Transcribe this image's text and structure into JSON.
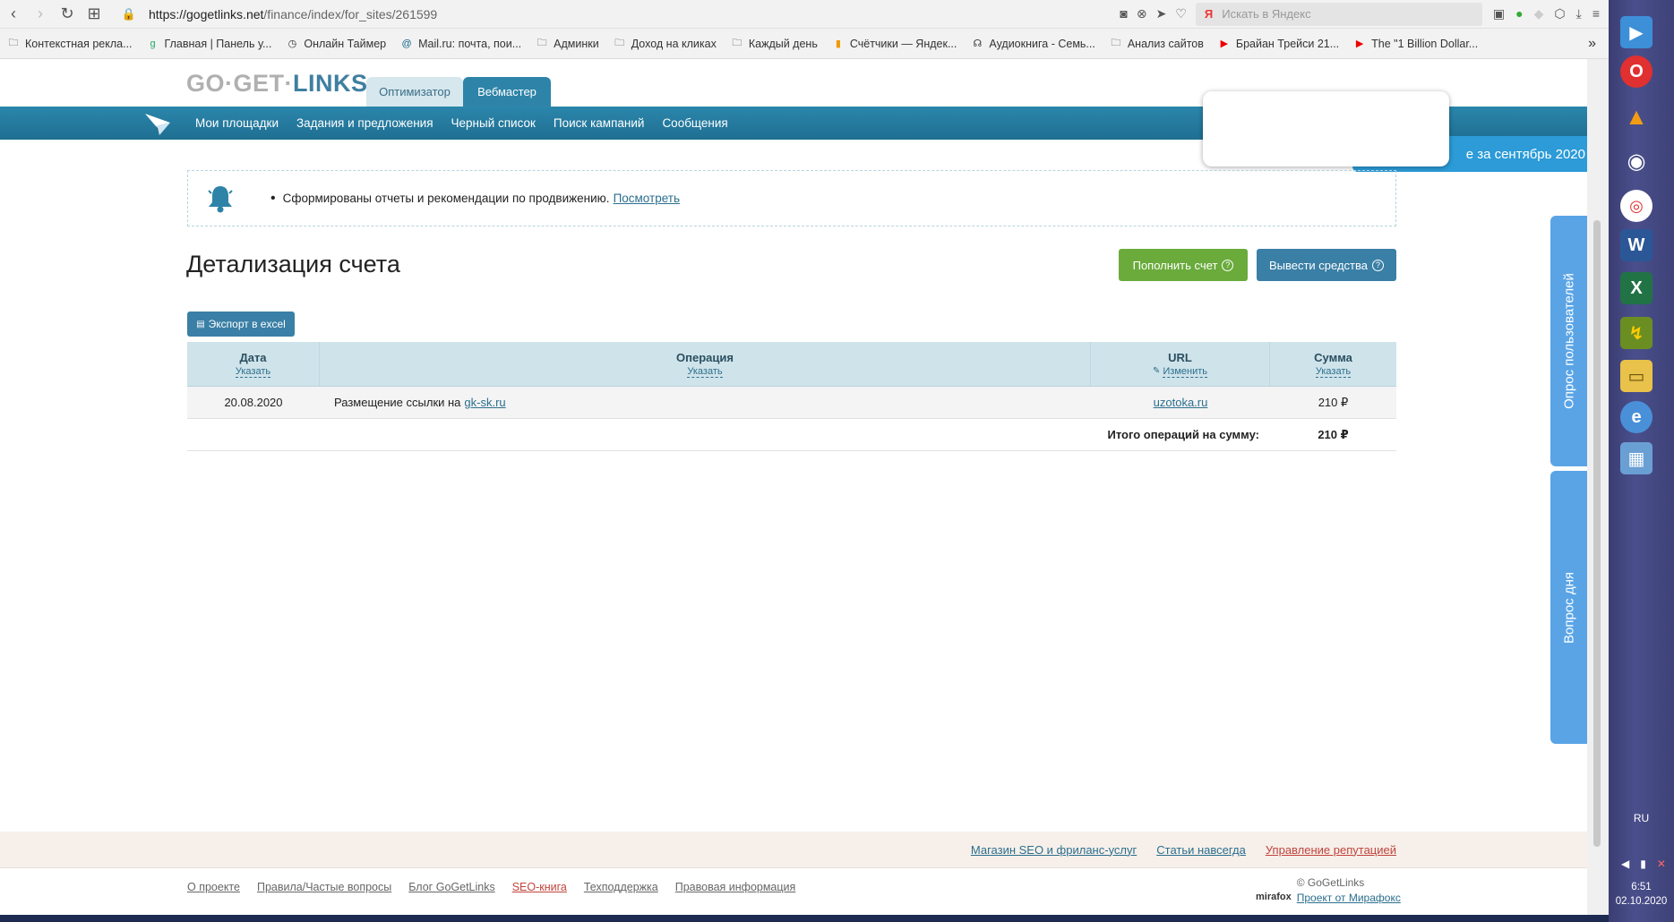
{
  "browser": {
    "url_host": "https://gogetlinks.net",
    "url_path": "/finance/index/for_sites/261599",
    "search_placeholder": "Искать в Яндекс",
    "bookmarks": [
      {
        "label": "Контекстная рекла...",
        "icon": "folder-icon"
      },
      {
        "label": "Главная | Панель у...",
        "icon": "g-icon"
      },
      {
        "label": "Онлайн Таймер",
        "icon": "clock-icon"
      },
      {
        "label": "Mail.ru: почта, пои...",
        "icon": "mail-icon"
      },
      {
        "label": "Админки",
        "icon": "folder-icon"
      },
      {
        "label": "Доход на кликах",
        "icon": "folder-icon"
      },
      {
        "label": "Каждый день",
        "icon": "folder-icon"
      },
      {
        "label": "Счётчики — Яндек...",
        "icon": "metrika-icon"
      },
      {
        "label": "Аудиокнига - Семь...",
        "icon": "headphones-icon"
      },
      {
        "label": "Анализ сайтов",
        "icon": "folder-icon"
      },
      {
        "label": "Брайан Трейси 21...",
        "icon": "youtube-icon"
      },
      {
        "label": "The \"1 Billion Dollar...",
        "icon": "youtube-icon"
      }
    ],
    "more": "»"
  },
  "site": {
    "logo_part1": "GO·GET·",
    "logo_part2": "LINKS",
    "mode_tabs": {
      "optimizer": "Оптимизатор",
      "webmaster": "Вебмастер"
    },
    "nav": [
      "Мои площадки",
      "Задания и предложения",
      "Черный список",
      "Поиск кампаний",
      "Сообщения"
    ],
    "promo": "е за сентябрь 2020",
    "notice": {
      "text": "Сформированы отчеты и рекомендации по продвижению.",
      "link": "Посмотреть"
    },
    "page_title": "Детализация счета",
    "buttons": {
      "deposit": "Пополнить счет",
      "withdraw": "Вывести средства",
      "export": "Экспорт в excel",
      "help_glyph": "?"
    },
    "table": {
      "headers": [
        {
          "title": "Дата",
          "sub": "Указать"
        },
        {
          "title": "Операция",
          "sub": "Указать"
        },
        {
          "title": "URL",
          "sub": "Изменить"
        },
        {
          "title": "Сумма",
          "sub": "Указать"
        }
      ],
      "rows": [
        {
          "date": "20.08.2020",
          "operation": "Размещение ссылки на",
          "operation_link": "gk-sk.ru",
          "url": "uzotoka.ru",
          "sum": "210 ₽"
        }
      ],
      "total_label": "Итого операций на сумму:",
      "total_value": "210 ₽"
    },
    "side_tabs": {
      "poll": "Опрос пользователей",
      "question": "Вопрос дня"
    },
    "footer_top": [
      "Магазин SEO и фриланс-услуг",
      "Статьи навсегда",
      "Управление репутацией"
    ],
    "footer_links": [
      "О проекте",
      "Правила/Частые вопросы",
      "Блог GoGetLinks",
      "SEO-книга",
      "Техподдержка",
      "Правовая информация"
    ],
    "copyright": "© GoGetLinks",
    "mirafox_link": "Проект от Мирафокс",
    "mirafox_logo": "mirafox"
  },
  "taskbar": {
    "icons": [
      "media-player-icon",
      "opera-icon",
      "vlc-icon",
      "eye-icon",
      "chrome-icon",
      "word-icon",
      "excel-icon",
      "app-icon",
      "folder-icon",
      "ie-icon",
      "computer-icon"
    ],
    "lang": "RU",
    "time": "6:51",
    "date": "02.10.2020"
  },
  "colors": {
    "nav_blue": "#1f6f92",
    "green_button": "#6aab3c",
    "blue_button": "#3a7fa6",
    "side_tab": "#5aa4e6",
    "link": "#2b6f8e",
    "red_link": "#c0443c"
  }
}
